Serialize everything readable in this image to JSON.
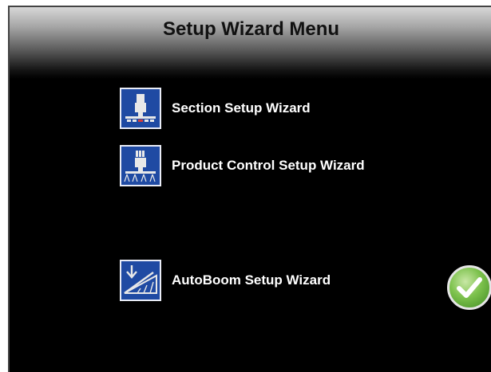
{
  "header": {
    "title": "Setup Wizard Menu"
  },
  "menu": {
    "items": [
      {
        "label": "Section Setup Wizard",
        "icon": "sprayer-section-icon"
      },
      {
        "label": "Product Control Setup Wizard",
        "icon": "sprayer-product-control-icon"
      },
      {
        "label": "AutoBoom Setup Wizard",
        "icon": "autoboom-icon"
      }
    ]
  },
  "actions": {
    "confirm_icon": "checkmark-icon"
  },
  "colors": {
    "background": "#000000",
    "icon_background": "#1f4aa3",
    "confirm_green": "#5aa832",
    "label_text": "#ffffff"
  }
}
